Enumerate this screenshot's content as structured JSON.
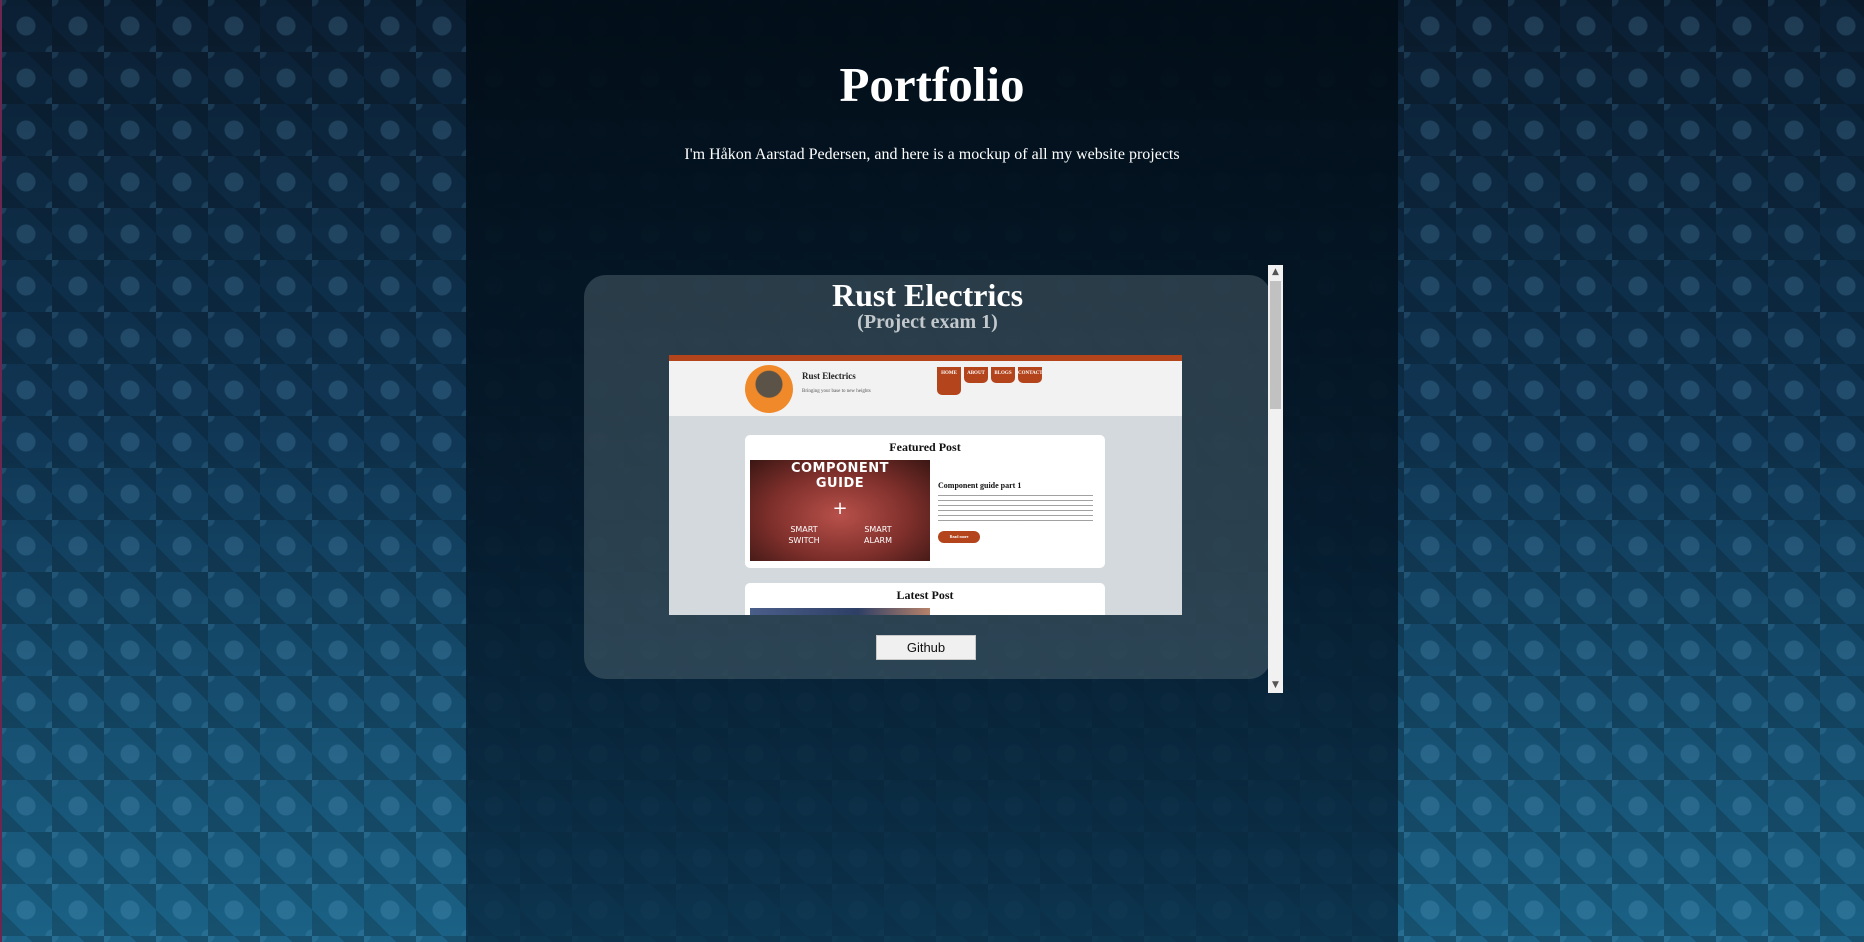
{
  "page": {
    "title": "Portfolio",
    "subtitle": "I'm Håkon Aarstad Pedersen, and here is a mockup of all my website projects"
  },
  "project": {
    "title": "Rust Electrics",
    "subtitle": "(Project exam 1)",
    "github_label": "Github",
    "preview": {
      "brand": "Rust Electrics",
      "tagline": "Bringing your base to new heights",
      "nav": [
        "HOME",
        "ABOUT",
        "BLOGS",
        "CONTACT"
      ],
      "featured_heading": "Featured Post",
      "featured_image": {
        "title_line1": "COMPONENT",
        "title_line2": "GUIDE",
        "plus": "+",
        "left_line1": "SMART",
        "left_line2": "SWITCH",
        "right_line1": "SMART",
        "right_line2": "ALARM"
      },
      "featured_post_title": "Component guide part 1",
      "read_more_label": "Read more",
      "latest_heading": "Latest Post"
    }
  },
  "scrollbar": {
    "up_arrow": "▲",
    "down_arrow": "▼"
  },
  "colors": {
    "accent": "#b3441c",
    "page_background": "#0f3150",
    "card_background": "#4a5b64"
  }
}
